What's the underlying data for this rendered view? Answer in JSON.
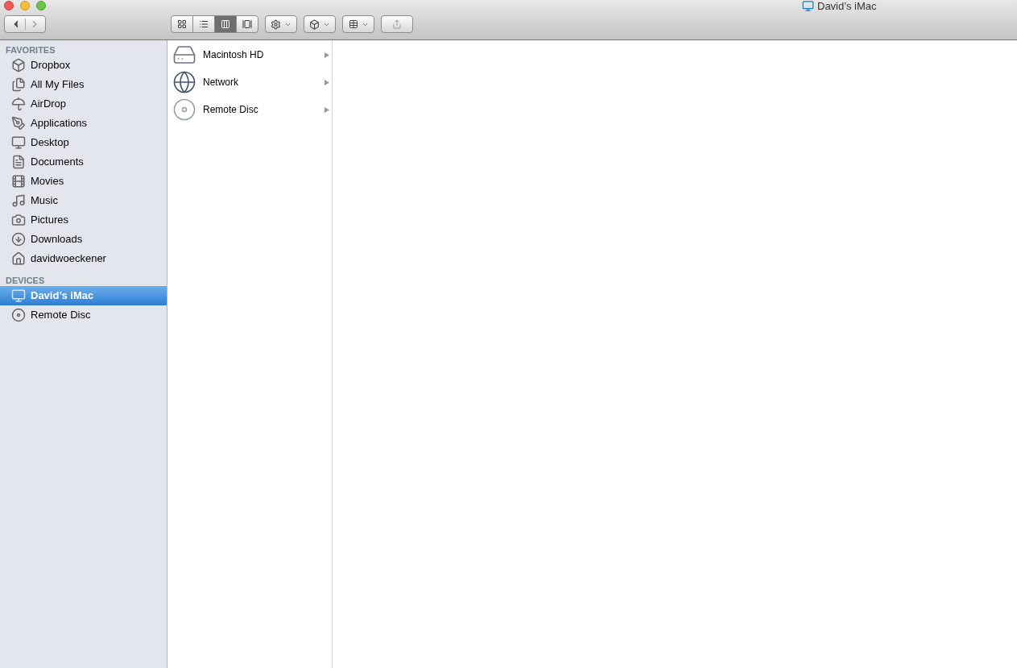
{
  "window": {
    "title": "David’s iMac"
  },
  "toolbar": {
    "view_modes": [
      {
        "kind": "icons",
        "selected": false
      },
      {
        "kind": "list",
        "selected": false
      },
      {
        "kind": "columns",
        "selected": true
      },
      {
        "kind": "coverflow",
        "selected": false
      }
    ]
  },
  "sidebar": {
    "sections": [
      {
        "heading": "FAVORITES",
        "items": [
          {
            "label": "Dropbox",
            "kind": "dropbox",
            "selected": false
          },
          {
            "label": "All My Files",
            "kind": "files",
            "selected": false
          },
          {
            "label": "AirDrop",
            "kind": "airdrop",
            "selected": false
          },
          {
            "label": "Applications",
            "kind": "apps",
            "selected": false
          },
          {
            "label": "Desktop",
            "kind": "desktop",
            "selected": false
          },
          {
            "label": "Documents",
            "kind": "documents",
            "selected": false
          },
          {
            "label": "Movies",
            "kind": "movies",
            "selected": false
          },
          {
            "label": "Music",
            "kind": "music",
            "selected": false
          },
          {
            "label": "Pictures",
            "kind": "pictures",
            "selected": false
          },
          {
            "label": "Downloads",
            "kind": "downloads",
            "selected": false
          },
          {
            "label": "davidwoeckener",
            "kind": "home",
            "selected": false
          }
        ]
      },
      {
        "heading": "DEVICES",
        "items": [
          {
            "label": "David’s iMac",
            "kind": "computer",
            "selected": true
          },
          {
            "label": "Remote Disc",
            "kind": "disc",
            "selected": false
          }
        ]
      }
    ]
  },
  "column": {
    "items": [
      {
        "label": "Macintosh HD",
        "kind": "disk"
      },
      {
        "label": "Network",
        "kind": "network"
      },
      {
        "label": "Remote Disc",
        "kind": "disc"
      }
    ]
  }
}
